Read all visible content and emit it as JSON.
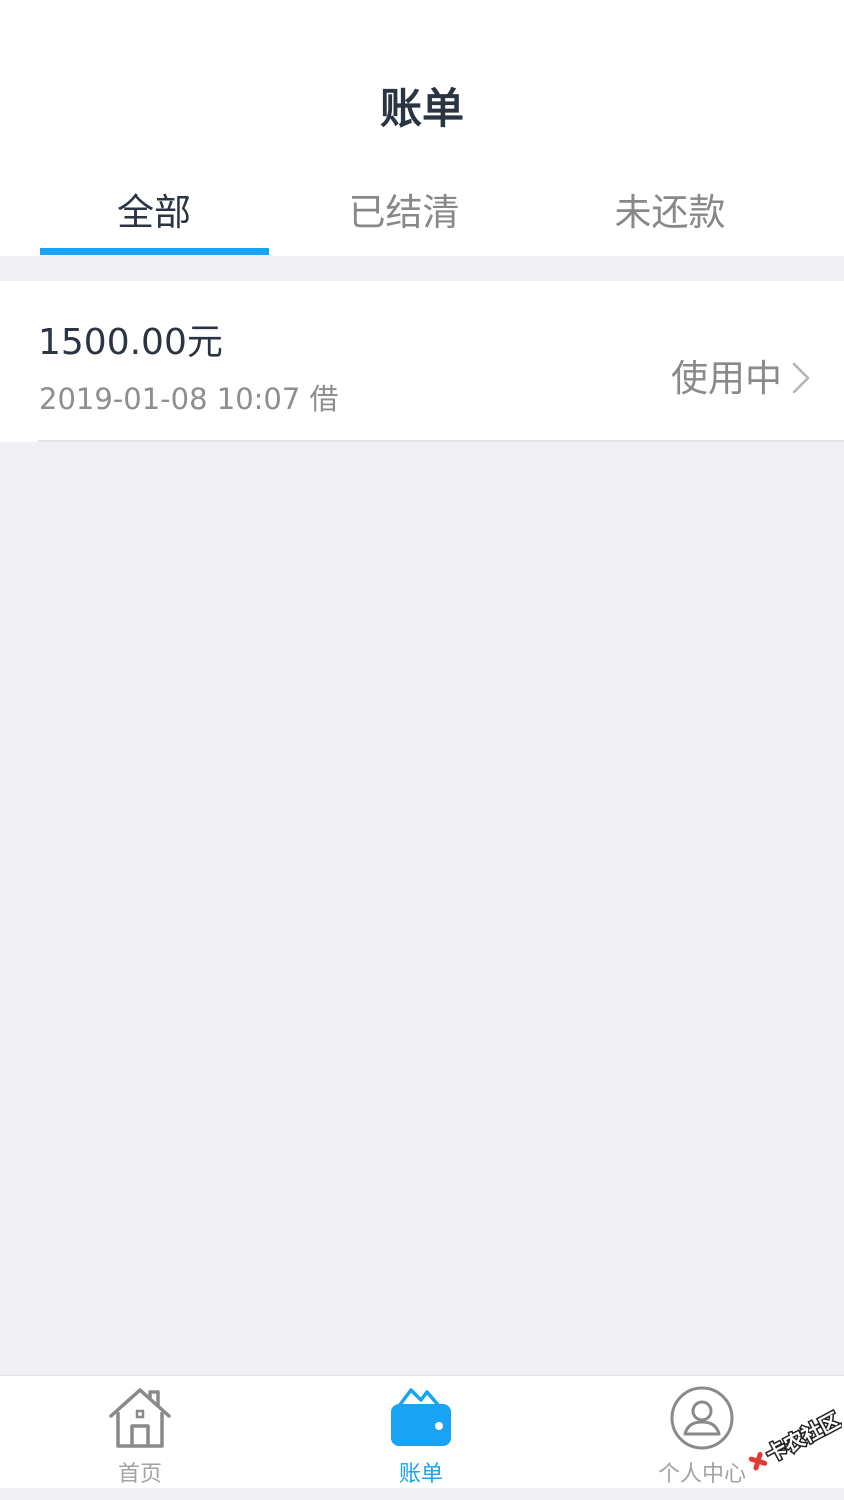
{
  "header": {
    "title": "账单"
  },
  "tabs": [
    {
      "label": "全部",
      "active": true
    },
    {
      "label": "已结清",
      "active": false
    },
    {
      "label": "未还款",
      "active": false
    }
  ],
  "bills": [
    {
      "amount": "1500.00元",
      "date": "2019-01-08 10:07 借",
      "status": "使用中"
    }
  ],
  "tabbar": {
    "items": [
      {
        "label": "首页",
        "icon": "home-icon",
        "active": false
      },
      {
        "label": "账单",
        "icon": "wallet-icon",
        "active": true
      },
      {
        "label": "个人中心",
        "icon": "user-icon",
        "active": false
      }
    ]
  },
  "watermark": {
    "text": "卡农社区"
  },
  "colors": {
    "accent": "#1aa3f4",
    "title_text": "#2b3443",
    "secondary_text": "#8e8e8e",
    "background": "#efeff4"
  }
}
